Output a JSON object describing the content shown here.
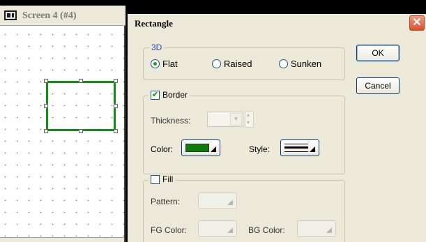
{
  "editor": {
    "title": "Screen 4 (#4)",
    "shape_color": "#118d11"
  },
  "dialog": {
    "title": "Rectangle",
    "ok_label": "OK",
    "cancel_label": "Cancel",
    "close_symbol": "✕",
    "three_d": {
      "label": "3D",
      "options": [
        "Flat",
        "Raised",
        "Sunken"
      ],
      "selected": "Flat"
    },
    "border": {
      "label": "Border",
      "checked": true,
      "thickness_label": "Thickness:",
      "color_label": "Color:",
      "color_value": "#0a7d0a",
      "style_label": "Style:"
    },
    "fill": {
      "label": "Fill",
      "checked": false,
      "pattern_label": "Pattern:",
      "fg_color_label": "FG Color:",
      "bg_color_label": "BG Color:"
    }
  }
}
